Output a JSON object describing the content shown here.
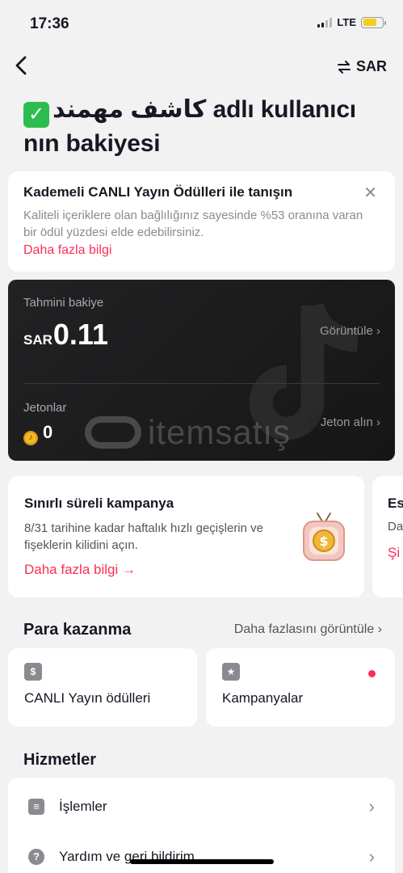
{
  "status_bar": {
    "time": "17:36",
    "network": "LTE"
  },
  "nav": {
    "back_icon": "chevron-left-icon",
    "currency_icon": "swap-icon",
    "currency_label": "SAR"
  },
  "page": {
    "title_name": "كاشف مهمند",
    "title_rest": " adlı kullanıcı nın bakiyesi"
  },
  "info_card": {
    "title": "Kademeli CANLI Yayın Ödülleri ile tanışın",
    "description": "Kaliteli içeriklere olan bağlılığınız sayesinde %53 oranına varan bir ödül yüzdesi elde edebilirsiniz.",
    "link": "Daha fazla bilgi"
  },
  "balance_card": {
    "estimated_label": "Tahmini bakiye",
    "currency": "SAR",
    "amount": "0.11",
    "view_link": "Görüntüle ›",
    "coins_label": "Jetonlar",
    "coins_value": "0",
    "get_coins_link": "Jeton alın ›",
    "watermark": "itemsatış"
  },
  "promo_cards": [
    {
      "title": "Sınırlı süreli kampanya",
      "description": "8/31 tarihine kadar haftalık hızlı geçişlerin ve fişeklerin kilidini açın.",
      "link": "Daha fazla bilgi →"
    },
    {
      "title": "Es",
      "description": "Da",
      "link": "Şi"
    }
  ],
  "earnings": {
    "section_title": "Para kazanma",
    "more_link": "Daha fazlasını görüntüle ›",
    "items": [
      {
        "label": "CANLI Yayın ödülleri",
        "icon": "money-bag-icon"
      },
      {
        "label": "Kampanyalar",
        "icon": "badge-star-icon"
      }
    ]
  },
  "services": {
    "section_title": "Hizmetler",
    "items": [
      {
        "label": "İşlemler",
        "icon": "document-icon"
      },
      {
        "label": "Yardım ve geri bildirim",
        "icon": "help-icon"
      }
    ]
  },
  "colors": {
    "accent": "#fe2c55",
    "balance_bg": "#1c1c1e",
    "check": "#2dbd4e"
  }
}
